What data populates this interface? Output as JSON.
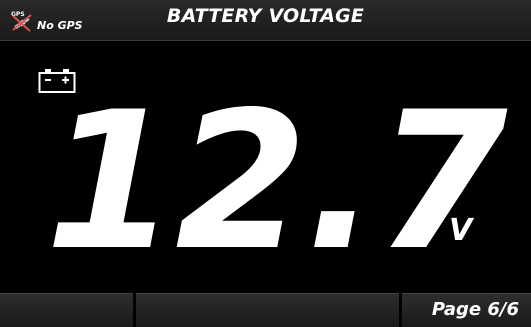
{
  "header": {
    "title": "BATTERY VOLTAGE",
    "gps_icon": "gps-crossed-satellite-icon",
    "gps_badge": "GPS",
    "gps_status": "No GPS"
  },
  "reading": {
    "icon": "battery-icon",
    "value": "12.7",
    "unit": "V"
  },
  "footer": {
    "softkeys": [
      "",
      "",
      ""
    ],
    "page_indicator": "Page 6/6"
  },
  "colors": {
    "background": "#000000",
    "text": "#ffffff",
    "gps_icon_accent": "#d9534f"
  }
}
